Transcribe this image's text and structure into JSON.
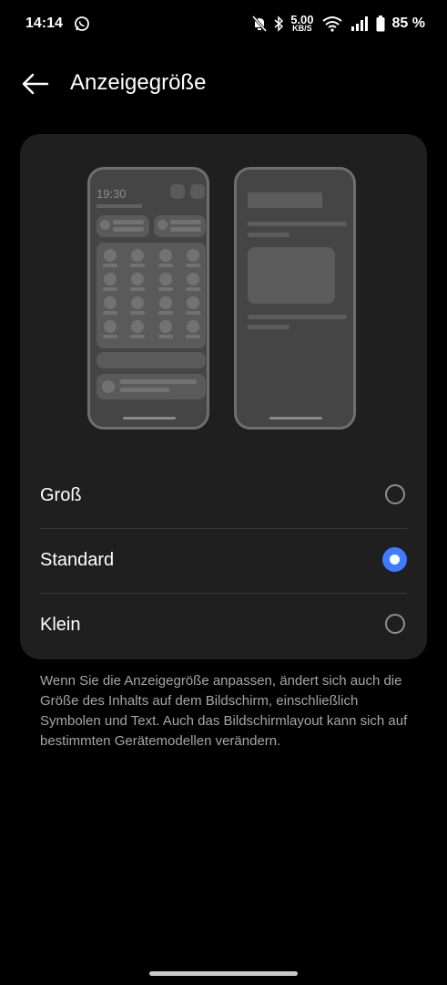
{
  "status_bar": {
    "time": "14:14",
    "speed_value": "5.00",
    "speed_unit": "KB/S",
    "battery_percent": "85 %",
    "icons": [
      "whatsapp-icon",
      "bell-muted-icon",
      "bluetooth-icon",
      "wifi-icon",
      "signal-icon",
      "battery-icon"
    ]
  },
  "header": {
    "title": "Anzeigegröße",
    "back_icon": "arrow-left-icon"
  },
  "preview": {
    "clock": "19:30"
  },
  "options": [
    {
      "label": "Groß",
      "selected": false
    },
    {
      "label": "Standard",
      "selected": true
    },
    {
      "label": "Klein",
      "selected": false
    }
  ],
  "description": "Wenn Sie die Anzeigegröße anpassen, ändert sich auch die Größe des Inhalts auf dem Bildschirm, einschließlich Symbolen und Text. Auch das Bildschirmlayout kann sich auf bestimmten Gerätemodellen verändern.",
  "colors": {
    "background": "#000000",
    "card": "#1f1f1f",
    "accent": "#3d7bff"
  }
}
